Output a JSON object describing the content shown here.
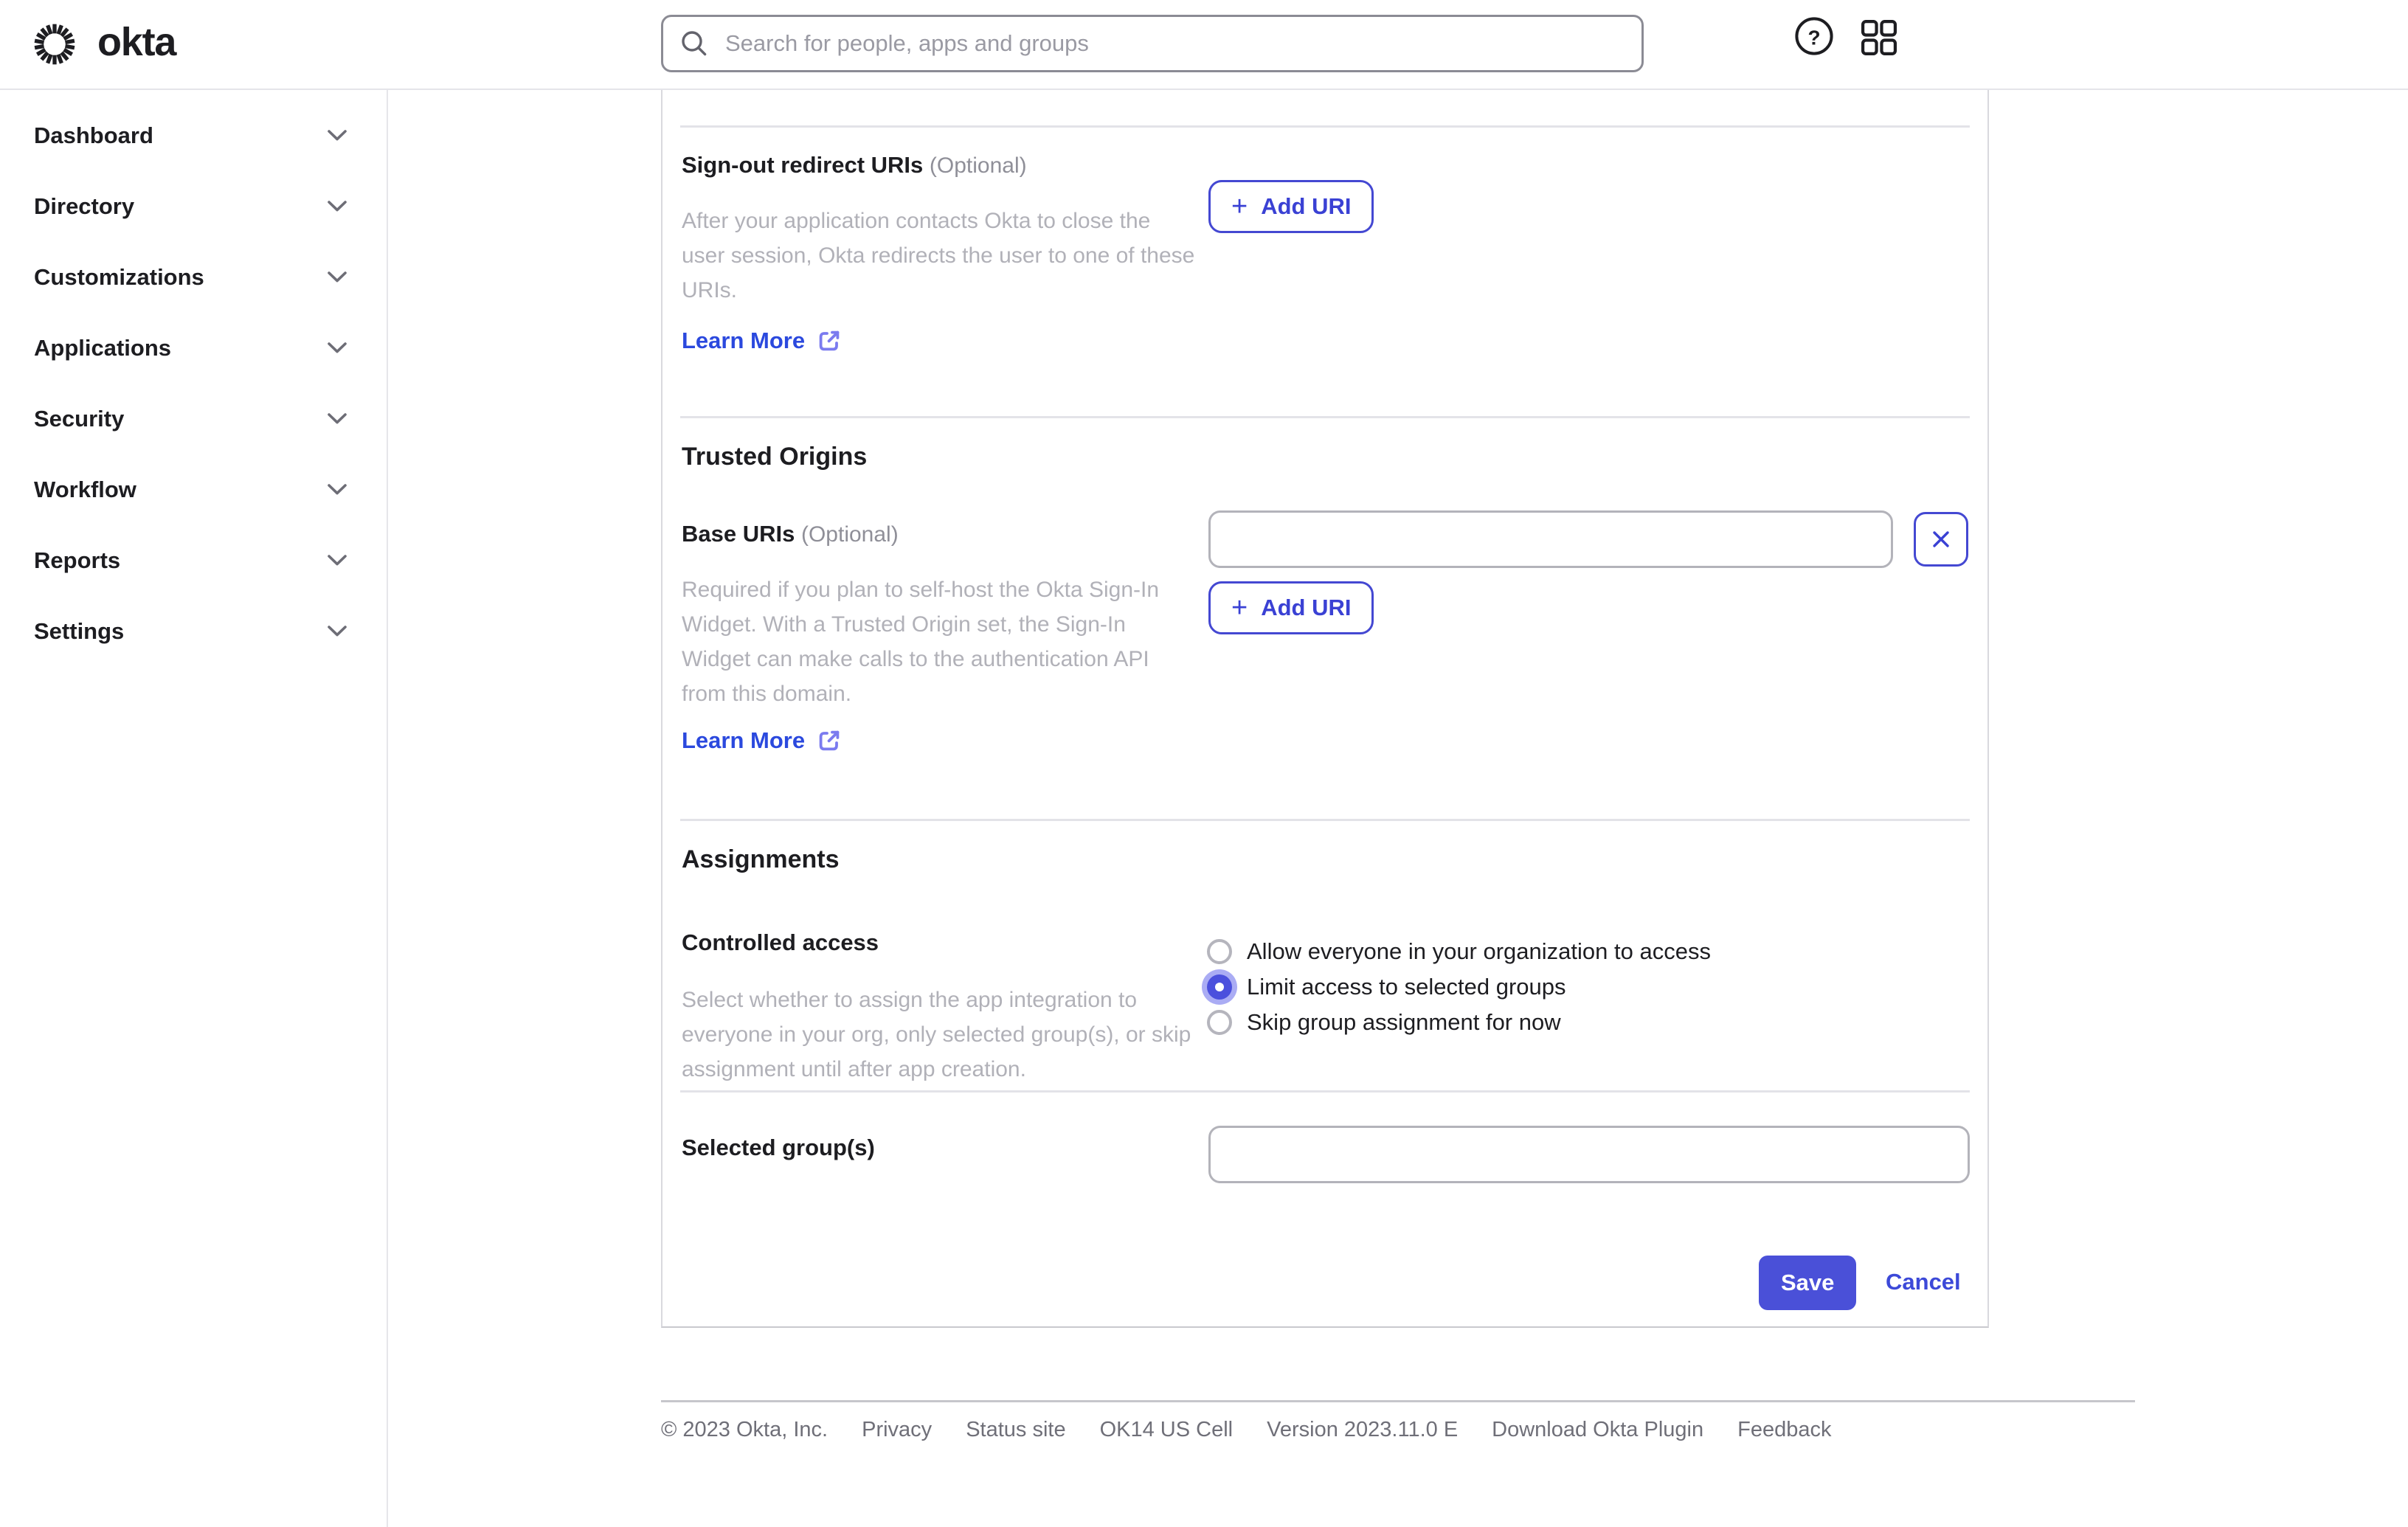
{
  "header": {
    "brand": "okta",
    "search_placeholder": "Search for people, apps and groups"
  },
  "sidebar": {
    "items": [
      {
        "label": "Dashboard"
      },
      {
        "label": "Directory"
      },
      {
        "label": "Customizations"
      },
      {
        "label": "Applications"
      },
      {
        "label": "Security"
      },
      {
        "label": "Workflow"
      },
      {
        "label": "Reports"
      },
      {
        "label": "Settings"
      }
    ]
  },
  "main": {
    "add_uri": {
      "plus": "+",
      "label": "Add URI"
    },
    "signout": {
      "label": "Sign-out redirect URIs",
      "optional": "(Optional)",
      "description": "After your application contacts Okta to close the user session, Okta redirects the user to one of these URIs.",
      "learn_more": "Learn More"
    },
    "trusted_origins": {
      "heading": "Trusted Origins",
      "base_uris_label": "Base URIs",
      "optional": "(Optional)",
      "base_uri_value": "",
      "description": "Required if you plan to self-host the Okta Sign-In Widget. With a Trusted Origin set, the Sign-In Widget can make calls to the authentication API from this domain.",
      "learn_more": "Learn More"
    },
    "assignments": {
      "heading": "Assignments",
      "controlled_access_label": "Controlled access",
      "description": "Select whether to assign the app integration to everyone in your org, only selected group(s), or skip assignment until after app creation.",
      "options": [
        {
          "label": "Allow everyone in your organization to access",
          "selected": false
        },
        {
          "label": "Limit access to selected groups",
          "selected": true
        },
        {
          "label": "Skip group assignment for now",
          "selected": false
        }
      ],
      "selected_groups_label": "Selected group(s)",
      "selected_groups_value": ""
    },
    "actions": {
      "save": "Save",
      "cancel": "Cancel"
    }
  },
  "footer": {
    "copyright": "© 2023 Okta, Inc.",
    "privacy": "Privacy",
    "status_site": "Status site",
    "cell": "OK14 US Cell",
    "version": "Version 2023.11.0 E",
    "download_plugin": "Download Okta Plugin",
    "feedback": "Feedback"
  },
  "colors": {
    "link_blue": "#2b49de",
    "button_blue": "#4448d2",
    "save_background": "#4a50d8",
    "radio_selected": "#4b50dd",
    "radio_halo": "#aaacf4",
    "text_primary": "#1d1d21",
    "text_muted": "#b1b1b8",
    "divider": "#e3e3e8"
  }
}
